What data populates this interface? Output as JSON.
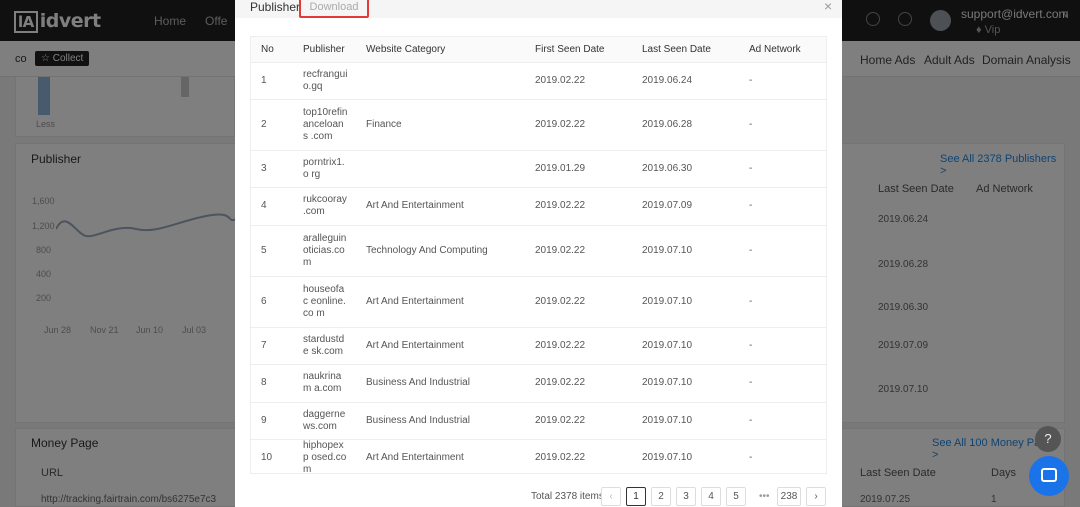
{
  "app": {
    "logo_mark": "lA",
    "logo_text": "idvert",
    "nav": [
      "Home",
      "Offe"
    ],
    "user_email": "support@idvert.com",
    "user_role": "Vip",
    "breadcrumb": "co",
    "collect_label": "Collect",
    "subtabs": [
      "Home Ads",
      "Adult Ads",
      "Domain Analysis"
    ],
    "publisher_card_title": "Publisher",
    "publisher_see_all": "See All 2378 Publishers >",
    "chart_y_ticks": [
      "1,600",
      "1,200",
      "800",
      "400",
      "200"
    ],
    "chart_x_ticks": [
      "Jun 28",
      "Nov 21",
      "Jun 10",
      "Jul 03"
    ],
    "bg_table_headers": [
      "Last Seen Date",
      "Ad Network"
    ],
    "bg_table_dates": [
      "2019.06.24",
      "2019.06.28",
      "2019.06.30",
      "2019.07.09",
      "2019.07.10"
    ],
    "money_card_title": "Money Page",
    "money_see_all": "See All 100 Money Pages >",
    "money_headers": [
      "URL",
      "Last Seen Date",
      "Days"
    ],
    "money_row": {
      "url": "http://tracking.fairtrain.com/bs6275e7c3",
      "date": "2019.07.25",
      "days": "1"
    },
    "bar_label": "Less"
  },
  "modal": {
    "tab_publisher": "Publisher",
    "tab_download": "Download",
    "close": "×",
    "columns": [
      "No",
      "Publisher",
      "Website Category",
      "First Seen Date",
      "Last Seen Date",
      "Ad Network"
    ],
    "rows": [
      {
        "no": "1",
        "publisher": "recfrangui o.gq",
        "category": "",
        "first": "2019.02.22",
        "last": "2019.06.24",
        "network": "-"
      },
      {
        "no": "2",
        "publisher": "top10refin anceloans .com",
        "category": "Finance",
        "first": "2019.02.22",
        "last": "2019.06.28",
        "network": "-"
      },
      {
        "no": "3",
        "publisher": "porntrix1.o rg",
        "category": "",
        "first": "2019.01.29",
        "last": "2019.06.30",
        "network": "-"
      },
      {
        "no": "4",
        "publisher": "rukcooray .com",
        "category": "Art And Entertainment",
        "first": "2019.02.22",
        "last": "2019.07.09",
        "network": "-"
      },
      {
        "no": "5",
        "publisher": "aralleguin oticias.co m",
        "category": "Technology And Computing",
        "first": "2019.02.22",
        "last": "2019.07.10",
        "network": "-"
      },
      {
        "no": "6",
        "publisher": "houseofac eonline.co m",
        "category": "Art And Entertainment",
        "first": "2019.02.22",
        "last": "2019.07.10",
        "network": "-"
      },
      {
        "no": "7",
        "publisher": "stardustde sk.com",
        "category": "Art And Entertainment",
        "first": "2019.02.22",
        "last": "2019.07.10",
        "network": "-"
      },
      {
        "no": "8",
        "publisher": "naukrinam a.com",
        "category": "Business And Industrial",
        "first": "2019.02.22",
        "last": "2019.07.10",
        "network": "-"
      },
      {
        "no": "9",
        "publisher": "daggerne ws.com",
        "category": "Business And Industrial",
        "first": "2019.02.22",
        "last": "2019.07.10",
        "network": "-"
      },
      {
        "no": "10",
        "publisher": "hiphopexp osed.com",
        "category": "Art And Entertainment",
        "first": "2019.02.22",
        "last": "2019.07.10",
        "network": "-"
      }
    ],
    "pagination": {
      "total": "Total 2378 items",
      "prev": "‹",
      "pages": [
        "1",
        "2",
        "3",
        "4",
        "5"
      ],
      "ellipsis": "•••",
      "last_page": "238",
      "next": "›",
      "current": "1"
    }
  },
  "floating": {
    "help": "?"
  }
}
